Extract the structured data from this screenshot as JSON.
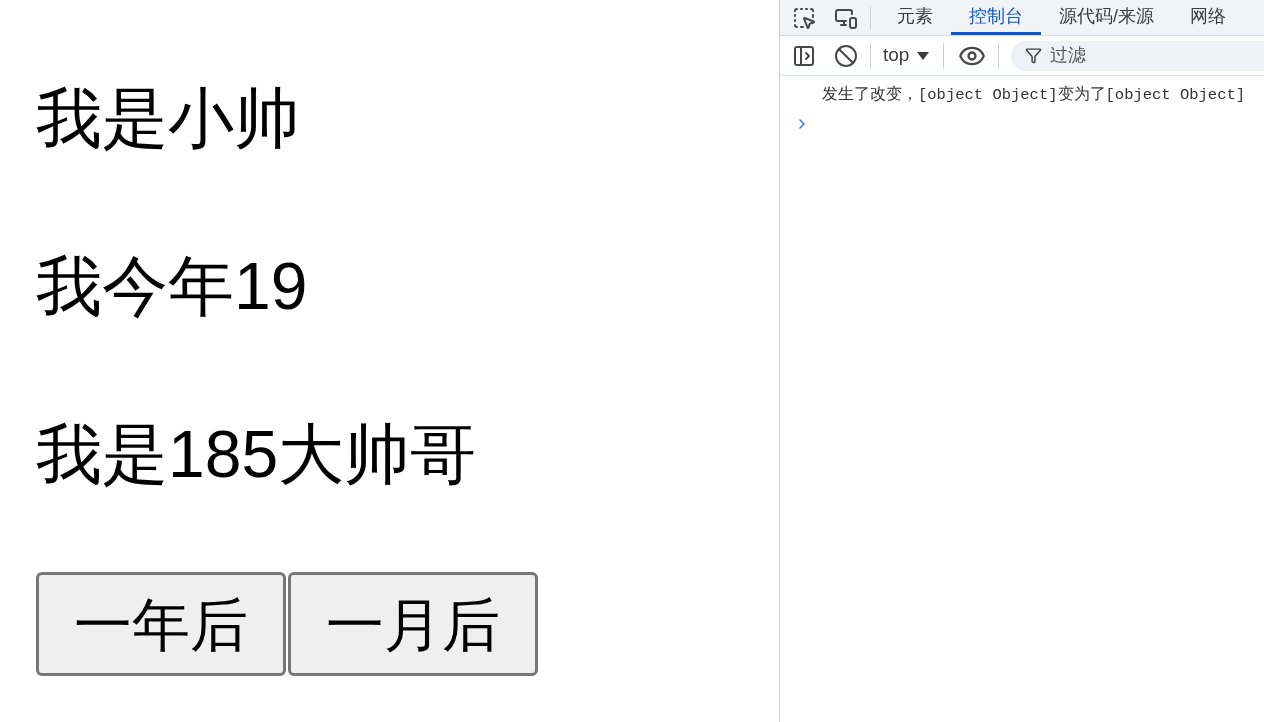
{
  "page": {
    "headings": [
      "我是小帅",
      "我今年19",
      "我是185大帅哥"
    ],
    "buttons": [
      "一年后",
      "一月后"
    ]
  },
  "devtools": {
    "tabs": [
      {
        "label": "元素",
        "selected": false
      },
      {
        "label": "控制台",
        "selected": true
      },
      {
        "label": "源代码/来源",
        "selected": false
      },
      {
        "label": "网络",
        "selected": false
      }
    ],
    "context": "top",
    "filter": {
      "placeholder": "过滤"
    },
    "console_messages": [
      "发生了改变，[object Object]变为了[object Object]"
    ]
  }
}
